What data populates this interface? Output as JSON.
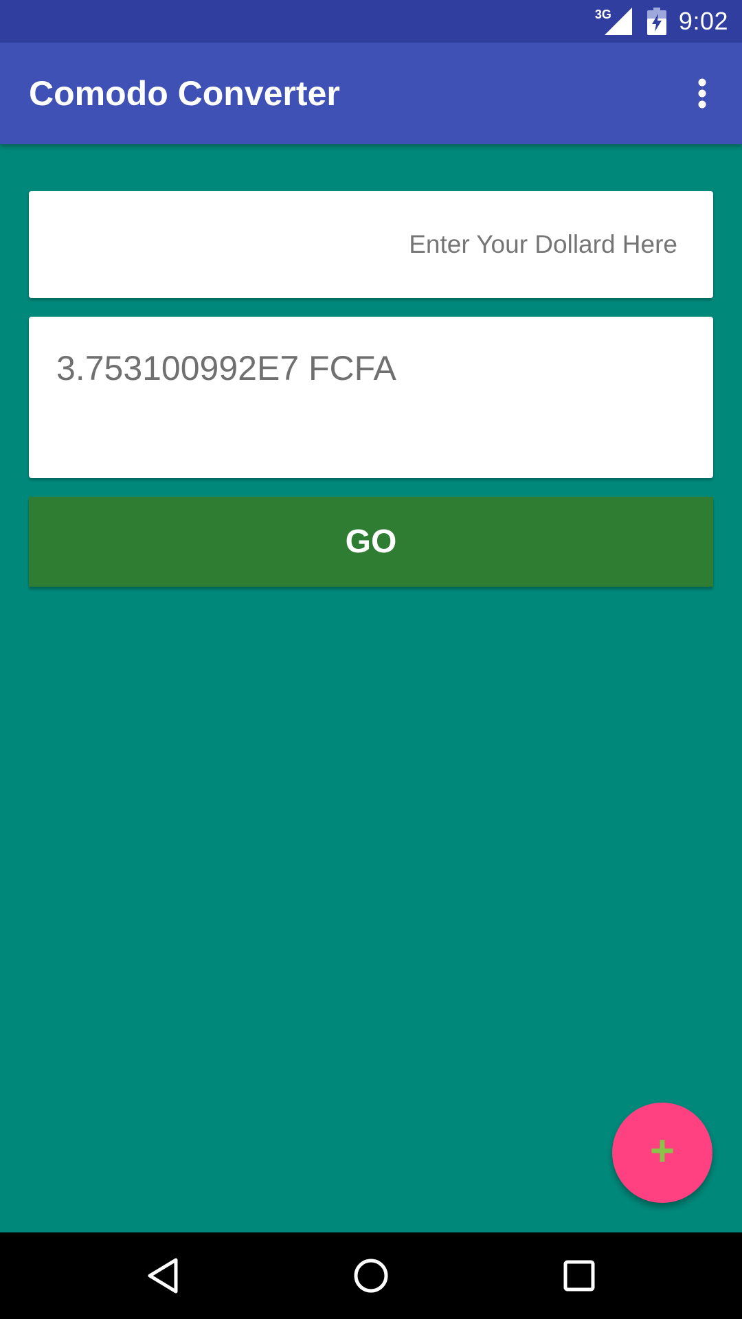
{
  "status_bar": {
    "network_type": "3G",
    "time": "9:02",
    "icons": [
      "signal-icon",
      "battery-charging-icon"
    ]
  },
  "app_bar": {
    "title": "Comodo Converter",
    "overflow_icon": "more-vert-icon"
  },
  "dollar_input": {
    "placeholder": "Enter Your Dollard Here",
    "value": ""
  },
  "result": {
    "text": "3.753100992E7 FCFA"
  },
  "go_button": {
    "label": "GO"
  },
  "fab": {
    "symbol": "+",
    "icon": "add-icon"
  },
  "nav_bar": {
    "icons": [
      "back-icon",
      "home-icon",
      "recents-icon"
    ]
  },
  "colors": {
    "status_bar": "#303f9f",
    "app_bar": "#3f51b5",
    "background": "#00897b",
    "go_button": "#2e7d32",
    "fab": "#ff4081",
    "fab_icon": "#8bc34a"
  }
}
